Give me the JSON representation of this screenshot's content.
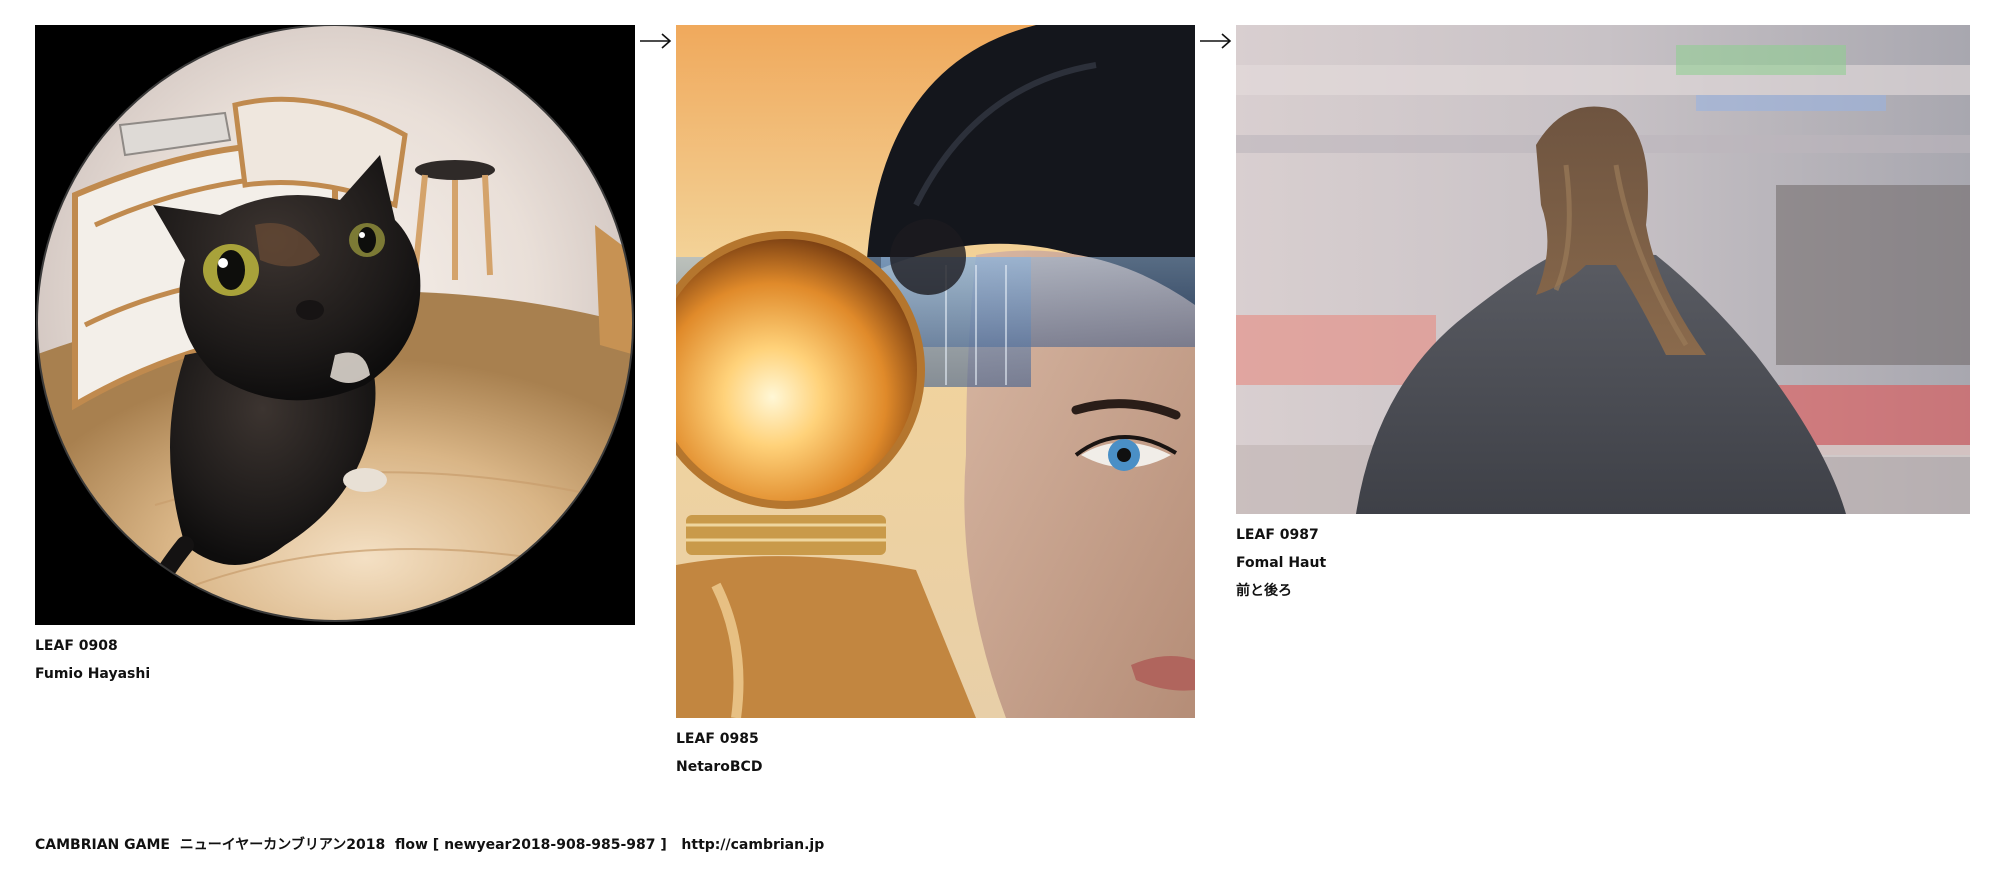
{
  "flow": {
    "leaves": [
      {
        "id": "LEAF 0908",
        "author": "Fumio Hayashi",
        "title": ""
      },
      {
        "id": "LEAF 0985",
        "author": "NetaroBCD",
        "title": ""
      },
      {
        "id": "LEAF 0987",
        "author": "Fomal Haut",
        "title": "前と後ろ"
      }
    ],
    "arrow_glyph": "→"
  },
  "footer": {
    "text": "CAMBRIAN GAME  ニューイヤーカンブリアン2018  flow [ newyear2018-908-985-987 ]   ",
    "link": "http://cambrian.jp"
  }
}
